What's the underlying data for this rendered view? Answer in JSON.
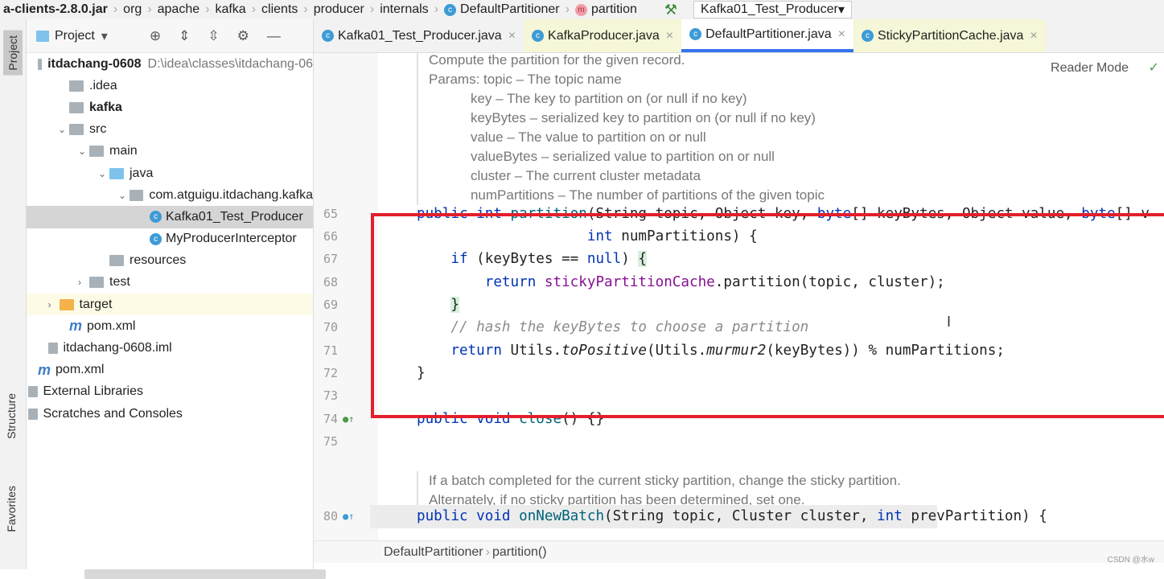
{
  "breadcrumb": {
    "items": [
      "a-clients-2.8.0.jar",
      "org",
      "apache",
      "kafka",
      "clients",
      "producer",
      "internals",
      "DefaultPartitioner",
      "partition"
    ],
    "run_config": "Kafka01_Test_Producer"
  },
  "toolstrip": {
    "project": "Project",
    "structure": "Structure",
    "favorites": "Favorites"
  },
  "sidebar": {
    "title": "Project",
    "tree": [
      {
        "label": "itdachang-0608",
        "extra": "D:\\idea\\classes\\itdachang-06",
        "indent": 0,
        "bold": true,
        "icon": "module"
      },
      {
        "label": ".idea",
        "indent": 1,
        "icon": "folder"
      },
      {
        "label": "kafka",
        "indent": 1,
        "bold": true,
        "icon": "module"
      },
      {
        "label": "src",
        "indent": 1,
        "arrow": "down",
        "icon": "folder"
      },
      {
        "label": "main",
        "indent": 2,
        "arrow": "down",
        "icon": "folder"
      },
      {
        "label": "java",
        "indent": 3,
        "arrow": "down",
        "icon": "folder-blue"
      },
      {
        "label": "com.atguigu.itdachang.kafka",
        "indent": 4,
        "arrow": "down",
        "icon": "package"
      },
      {
        "label": "Kafka01_Test_Producer",
        "indent": 5,
        "icon": "class",
        "selected": true
      },
      {
        "label": "MyProducerInterceptor",
        "indent": 5,
        "icon": "class"
      },
      {
        "label": "resources",
        "indent": 3,
        "icon": "folder"
      },
      {
        "label": "test",
        "indent": 2,
        "arrow": "right",
        "icon": "folder"
      },
      {
        "label": "target",
        "indent": 0.5,
        "arrow": "right",
        "icon": "folder-orange",
        "highlight": true
      },
      {
        "label": "pom.xml",
        "indent": 1,
        "icon": "maven"
      },
      {
        "label": "itdachang-0608.iml",
        "indent": 0.5,
        "icon": "file"
      },
      {
        "label": "pom.xml",
        "indent": 0,
        "icon": "maven"
      },
      {
        "label": "External Libraries",
        "indent": -0.5,
        "icon": "library"
      },
      {
        "label": "Scratches and Consoles",
        "indent": -0.5,
        "icon": "scratch"
      }
    ]
  },
  "tabs": [
    {
      "label": "Kafka01_Test_Producer.java"
    },
    {
      "label": "KafkaProducer.java",
      "yellow": true
    },
    {
      "label": "DefaultPartitioner.java",
      "active": true
    },
    {
      "label": "StickyPartitionCache.java",
      "yellow": true
    }
  ],
  "editor": {
    "reader_mode": "Reader Mode",
    "doc1": [
      "Compute the partition for the given record.",
      "Params: topic – The topic name",
      "           key – The key to partition on (or null if no key)",
      "           keyBytes – serialized key to partition on (or null if no key)",
      "           value – The value to partition on or null",
      "           valueBytes – serialized value to partition on or null",
      "           cluster – The current cluster metadata",
      "           numPartitions – The number of partitions of the given topic"
    ],
    "doc2": [
      "If a batch completed for the current sticky partition, change the sticky partition.",
      "Alternately, if no sticky partition has been determined, set one."
    ],
    "lines": [
      {
        "n": "65",
        "t": [
          [
            "public int ",
            "kw"
          ],
          [
            "partition",
            "fn"
          ],
          [
            "(String topic, Object key, ",
            ""
          ],
          [
            "byte",
            "kw"
          ],
          [
            "[] keyBytes, Object value, ",
            ""
          ],
          [
            "byte",
            "kw"
          ],
          [
            "[] v",
            ""
          ]
        ]
      },
      {
        "n": "66",
        "t": [
          [
            "                    ",
            ""
          ],
          [
            "int ",
            "kw"
          ],
          [
            "numPartitions) {",
            ""
          ]
        ]
      },
      {
        "n": "67",
        "t": [
          [
            "    ",
            ""
          ],
          [
            "if ",
            "kw"
          ],
          [
            "(keyBytes == ",
            ""
          ],
          [
            "null",
            "kw"
          ],
          [
            ") ",
            ""
          ],
          [
            "{",
            "br"
          ]
        ]
      },
      {
        "n": "68",
        "t": [
          [
            "        ",
            ""
          ],
          [
            "return ",
            "kw"
          ],
          [
            "stickyPartitionCache",
            "fld"
          ],
          [
            ".partition(topic, cluster);",
            ""
          ]
        ]
      },
      {
        "n": "69",
        "t": [
          [
            "    ",
            ""
          ],
          [
            "}",
            "br"
          ]
        ]
      },
      {
        "n": "70",
        "t": [
          [
            "    ",
            ""
          ],
          [
            "// hash the keyBytes to choose a partition",
            "cm"
          ]
        ]
      },
      {
        "n": "71",
        "t": [
          [
            "    ",
            ""
          ],
          [
            "return ",
            "kw"
          ],
          [
            "Utils.",
            ""
          ],
          [
            "toPositive",
            "st"
          ],
          [
            "(Utils.",
            ""
          ],
          [
            "murmur2",
            "st"
          ],
          [
            "(keyBytes)) % numPartitions;",
            ""
          ]
        ]
      },
      {
        "n": "72",
        "t": [
          [
            "}",
            ""
          ]
        ]
      },
      {
        "n": "73",
        "t": []
      },
      {
        "n": "74",
        "t": [
          [
            "public void ",
            "kw"
          ],
          [
            "close",
            "fn"
          ],
          [
            "() {}",
            ""
          ]
        ]
      },
      {
        "n": "75",
        "t": []
      },
      {
        "n": "80",
        "t": [
          [
            "public void ",
            "kw"
          ],
          [
            "onNewBatch",
            "fn"
          ],
          [
            "(String topic, Cluster cluster, ",
            ""
          ],
          [
            "int ",
            "kw"
          ],
          [
            "prevPartition) {",
            ""
          ]
        ]
      }
    ]
  },
  "status": {
    "crumbs": [
      "DefaultPartitioner",
      "partition()"
    ]
  },
  "watermark": "CSDN @水w",
  "colors": {
    "accent": "#3574f0",
    "highlight_box": "#e41f2b",
    "keyword": "#0033b3"
  }
}
